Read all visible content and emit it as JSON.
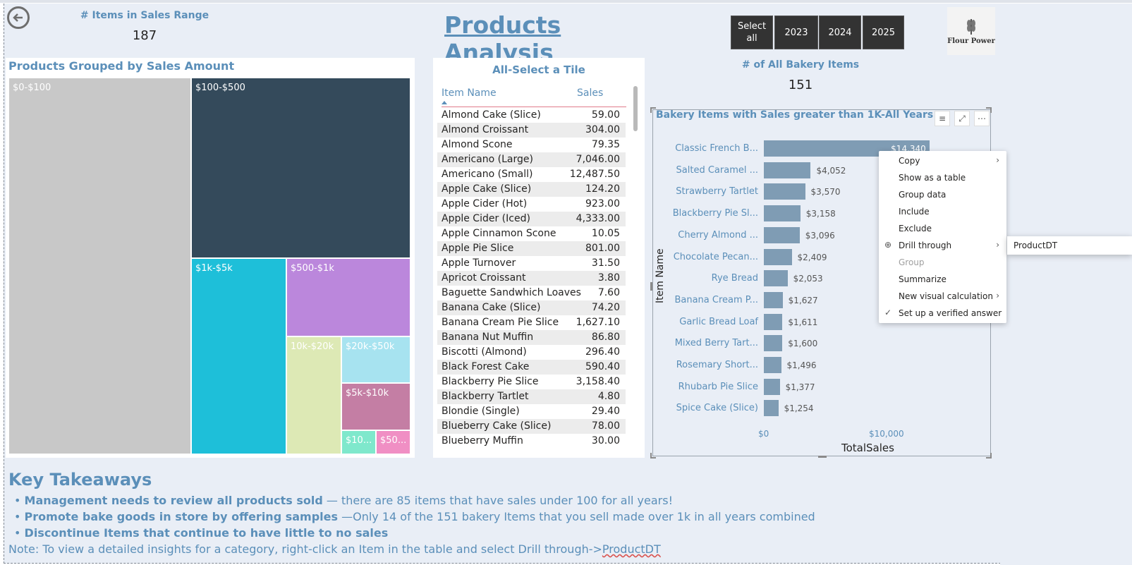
{
  "header": {
    "kpi_left": {
      "title": "# Items in Sales Range",
      "value": "187"
    },
    "page_title": "Products Analysis",
    "slicer": [
      "Select all",
      "2023",
      "2024",
      "2025"
    ],
    "logo_text": "Flour Power"
  },
  "treemap": {
    "title": "Products Grouped by Sales Amount",
    "tiles": [
      "$0-$100",
      "$100-$500",
      "$1k-$5k",
      "$500-$1k",
      "10k-$20k",
      "$20k-$50k",
      "$5k-$10k",
      "$10...",
      "$50..."
    ]
  },
  "table": {
    "title": "All-Select a Tile",
    "col_item": "Item Name",
    "col_sales": "Sales",
    "rows": [
      [
        "Almond Cake (Slice)",
        "59.00"
      ],
      [
        "Almond Croissant",
        "304.00"
      ],
      [
        "Almond Scone",
        "79.35"
      ],
      [
        "Americano (Large)",
        "7,046.00"
      ],
      [
        "Americano (Small)",
        "12,487.50"
      ],
      [
        "Apple Cake (Slice)",
        "124.20"
      ],
      [
        "Apple Cider (Hot)",
        "923.00"
      ],
      [
        "Apple Cider (Iced)",
        "4,333.00"
      ],
      [
        "Apple Cinnamon Scone",
        "10.05"
      ],
      [
        "Apple Pie Slice",
        "801.00"
      ],
      [
        "Apple Turnover",
        "31.50"
      ],
      [
        "Apricot Croissant",
        "3.80"
      ],
      [
        "Baguette Sandwhich Loaves",
        "7.60"
      ],
      [
        "Banana Cake (Slice)",
        "74.20"
      ],
      [
        "Banana Cream Pie Slice",
        "1,627.10"
      ],
      [
        "Banana Nut Muffin",
        "86.80"
      ],
      [
        "Biscotti (Almond)",
        "296.40"
      ],
      [
        "Black Forest Cake",
        "590.40"
      ],
      [
        "Blackberry Pie Slice",
        "3,158.40"
      ],
      [
        "Blackberry Tartlet",
        "4.80"
      ],
      [
        "Blondie (Single)",
        "29.40"
      ],
      [
        "Blueberry Cake (Slice)",
        "78.00"
      ],
      [
        "Blueberry Muffin",
        "30.00"
      ]
    ]
  },
  "kpi_right": {
    "title": "# of All Bakery Items",
    "value": "151"
  },
  "bar_chart_title": "Bakery Items with Sales greater than 1K-All Years",
  "chart_data": {
    "type": "bar",
    "orientation": "horizontal",
    "title": "Bakery Items with Sales greater than 1K-All Years",
    "xlabel": "TotalSales",
    "ylabel": "Item Name",
    "categories": [
      "Classic French B...",
      "Salted Caramel ...",
      "Strawberry Tartlet",
      "Blackberry Pie Sl...",
      "Cherry Almond ...",
      "Chocolate Pecan...",
      "Rye Bread",
      "Banana Cream P...",
      "Garlic Bread Loaf",
      "Mixed Berry Tart...",
      "Rosemary Short...",
      "Rhubarb Pie Slice",
      "Spice Cake (Slice)"
    ],
    "values": [
      14340,
      4052,
      3570,
      3158,
      3096,
      2409,
      2053,
      1627,
      1611,
      1600,
      1496,
      1377,
      1254
    ],
    "labels": [
      "$14,340",
      "$4,052",
      "$3,570",
      "$3,158",
      "$3,096",
      "$2,409",
      "$2,053",
      "$1,627",
      "$1,611",
      "$1,600",
      "$1,496",
      "$1,377",
      "$1,254"
    ],
    "x_ticks": [
      "$0",
      "$10,000"
    ],
    "xlim": [
      0,
      20000
    ],
    "bar_color": "#7f9cb4"
  },
  "context_menu": {
    "items": [
      "Copy",
      "Show as a table",
      "Group data",
      "Include",
      "Exclude",
      "Drill through",
      "Group",
      "Summarize",
      "New visual calculation",
      "Set up a verified answer"
    ],
    "submenu": "ProductDT"
  },
  "takeaways": {
    "title": "Key Takeaways",
    "b1_bold": "Management needs to review all products sold",
    "b1_rest": " — there are 85 items that have sales under 100 for all years!",
    "b2_bold": "Promote bake goods in store by offering samples",
    "b2_rest": " —Only 14 of the 151 bakery Items that you sell made over 1k in all years combined",
    "b3_bold": "Discontinue Items that continue to have little to no sales",
    "note_pre": "Note: To view a detailed insights for a category, right-click an Item in the table and select Drill through->",
    "note_link": "ProductDT"
  },
  "colors": {
    "accent": "#5b8fb9",
    "background": "#e9eef6"
  }
}
